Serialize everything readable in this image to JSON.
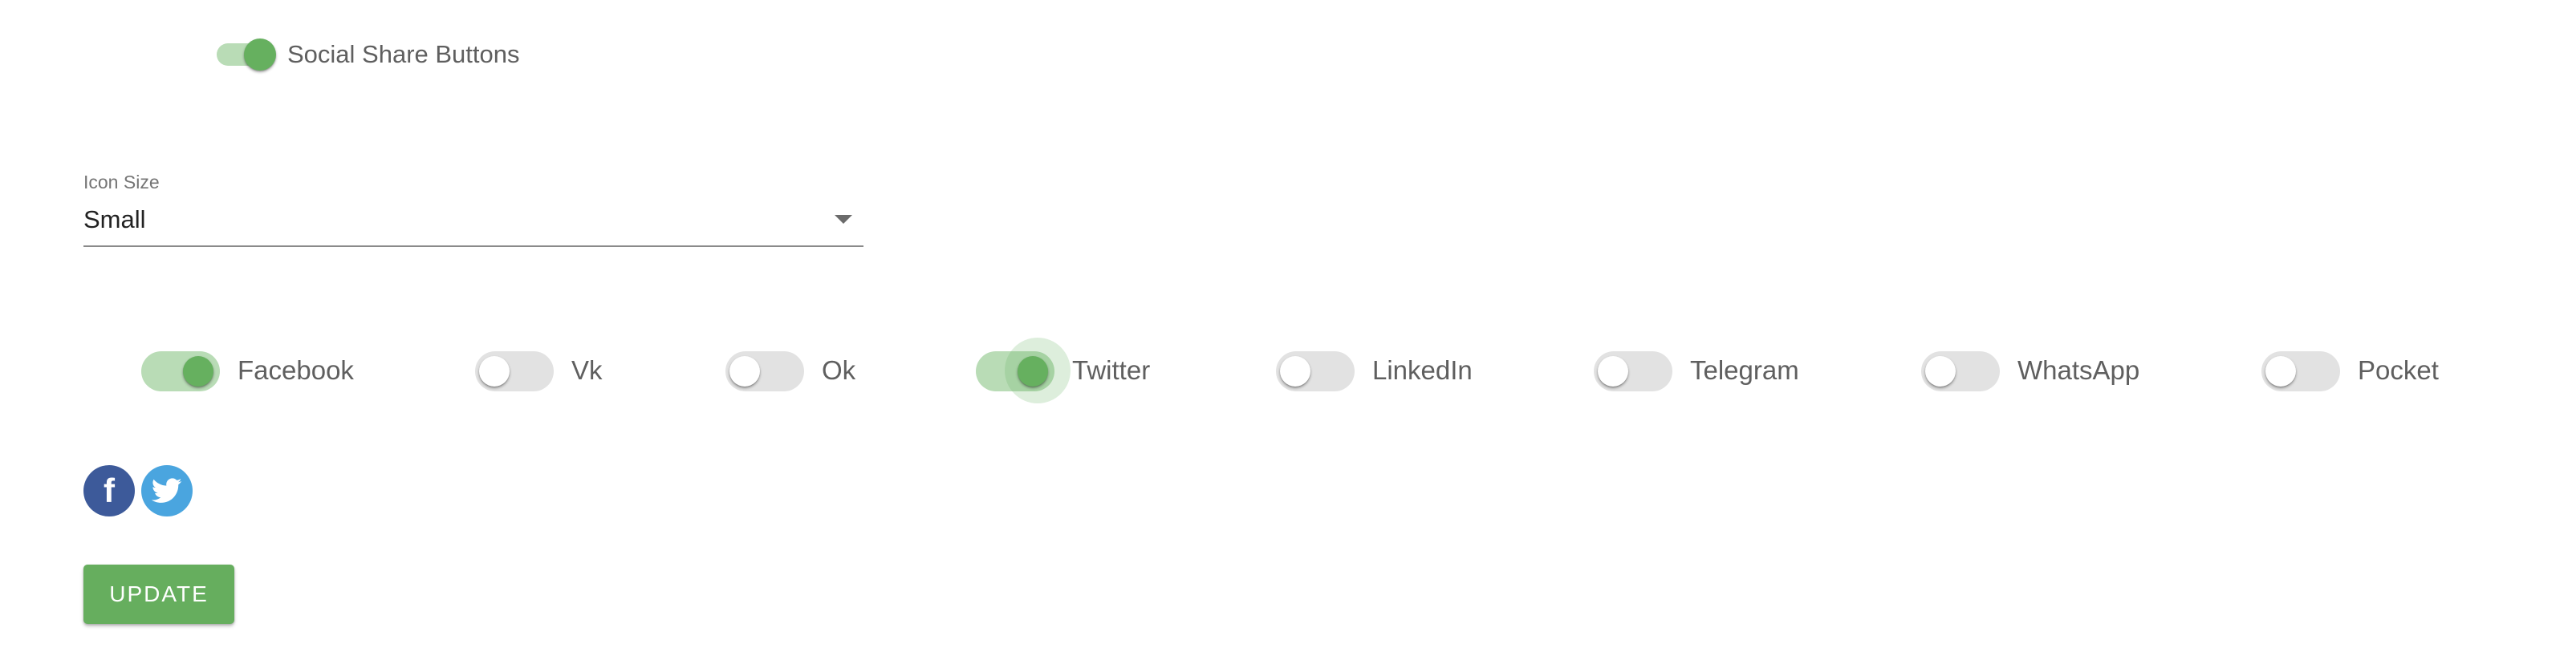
{
  "master_toggle": {
    "label": "Social Share Buttons",
    "on": true
  },
  "icon_size": {
    "label": "Icon Size",
    "value": "Small"
  },
  "networks": [
    {
      "label": "Facebook",
      "on": true
    },
    {
      "label": "Vk",
      "on": false
    },
    {
      "label": "Ok",
      "on": false
    },
    {
      "label": "Twitter",
      "on": true,
      "focused": true
    },
    {
      "label": "LinkedIn",
      "on": false
    },
    {
      "label": "Telegram",
      "on": false
    },
    {
      "label": "WhatsApp",
      "on": false
    },
    {
      "label": "Pocket",
      "on": false
    }
  ],
  "share_icons": [
    {
      "name": "facebook-icon",
      "glyph": "f",
      "color": "#3d5a9a"
    },
    {
      "name": "twitter-icon",
      "color": "#4aa5df"
    }
  ],
  "update_button": {
    "label": "UPDATE"
  },
  "colors": {
    "accent": "#66ae5e",
    "track_on": "#b9dcb6",
    "track_off": "#e2e2e2"
  }
}
